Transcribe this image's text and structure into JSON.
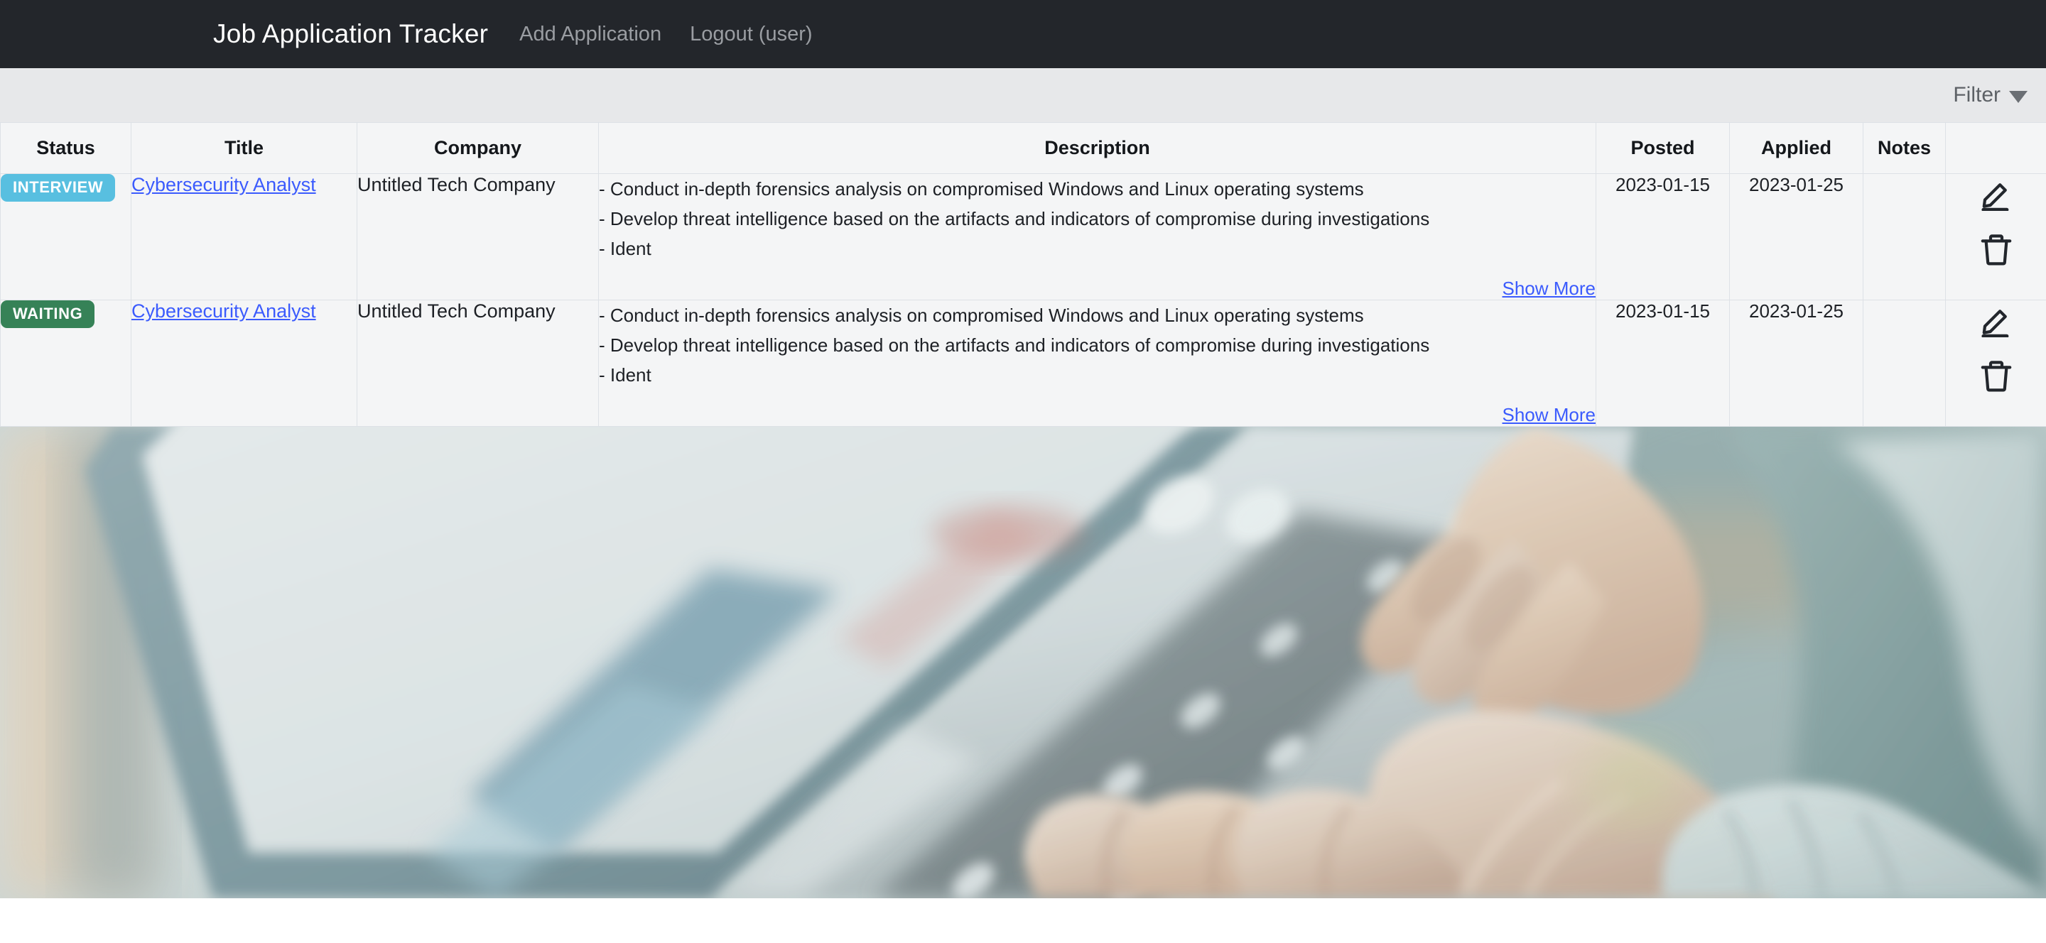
{
  "navbar": {
    "brand": "Job Application Tracker",
    "links": [
      {
        "label": "Add Application"
      },
      {
        "label": "Logout (user)"
      }
    ]
  },
  "filterbar": {
    "label": "Filter",
    "caret_icon": "chevron-down-icon"
  },
  "table": {
    "headers": [
      "Status",
      "Title",
      "Company",
      "Description",
      "Posted",
      "Applied",
      "Notes",
      ""
    ],
    "rows": [
      {
        "status": "INTERVIEW",
        "status_color": "#58bfe0",
        "title": "Cybersecurity Analyst",
        "company": "Untitled Tech Company",
        "description_lines": [
          "- Conduct in-depth forensics analysis on compromised Windows and Linux operating systems",
          "- Develop threat intelligence based on the artifacts and indicators of compromise during investigations",
          "- Ident"
        ],
        "show_more": "Show More",
        "posted": "2023-01-15",
        "applied": "2023-01-25",
        "notes": "",
        "actions": {
          "edit_icon": "pencil-edit-icon",
          "delete_icon": "trash-delete-icon"
        }
      },
      {
        "status": "WAITING",
        "status_color": "#368257",
        "title": "Cybersecurity Analyst",
        "company": "Untitled Tech Company",
        "description_lines": [
          "- Conduct in-depth forensics analysis on compromised Windows and Linux operating systems",
          "- Develop threat intelligence based on the artifacts and indicators of compromise during investigations",
          "- Ident"
        ],
        "show_more": "Show More",
        "posted": "2023-01-15",
        "applied": "2023-01-25",
        "notes": "",
        "actions": {
          "edit_icon": "pencil-edit-icon",
          "delete_icon": "trash-delete-icon"
        }
      }
    ]
  },
  "hero_photo": {
    "alt": "Close-up photo of hands typing on a laptop keyboard, desaturated teal tones"
  },
  "colors": {
    "navbar_bg": "#23262b",
    "filterbar_bg": "#e7e8ea",
    "table_bg": "#f4f5f6",
    "table_border": "#dde1e6",
    "link": "#3b5bfd",
    "status_interview": "#58bfe0",
    "status_waiting": "#368257"
  }
}
